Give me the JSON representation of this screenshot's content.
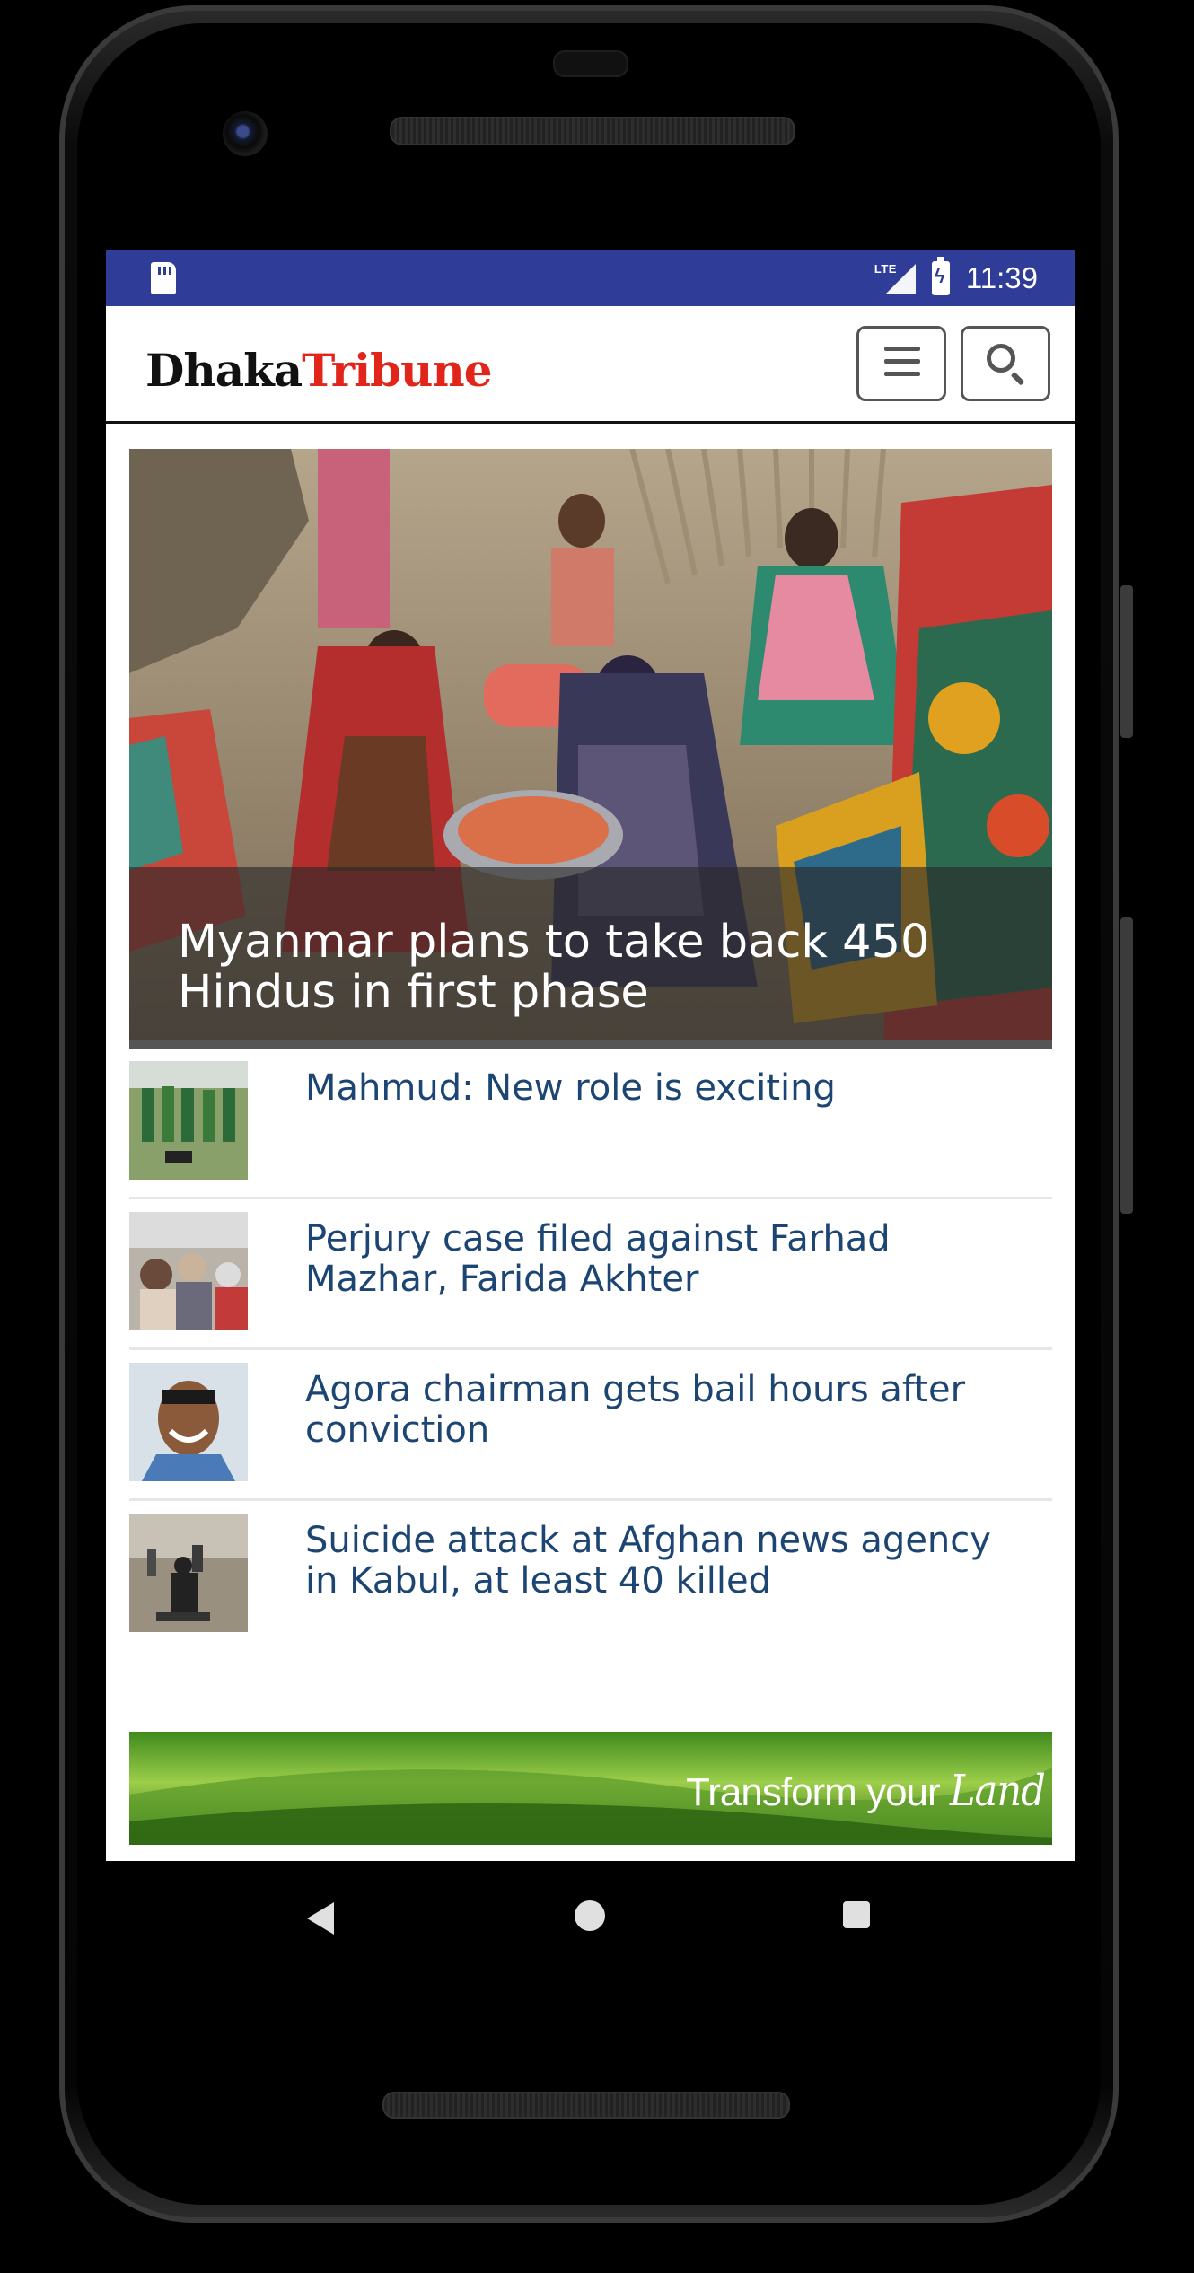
{
  "status_bar": {
    "network": "LTE",
    "time": "11:39",
    "icons": [
      "sd-card-icon",
      "lte-signal-icon",
      "battery-charging-icon"
    ]
  },
  "header": {
    "logo_part1": "Dhaka",
    "logo_part2": "Tribune",
    "icons": [
      "menu-icon",
      "search-icon"
    ]
  },
  "featured": {
    "headline": "Myanmar plans to take back 450 Hindus in first phase"
  },
  "news": [
    {
      "title": "Mahmud: New role is exciting"
    },
    {
      "title": "Perjury case filed against Farhad Mazhar, Farida Akhter"
    },
    {
      "title": "Agora chairman gets bail hours after conviction"
    },
    {
      "title": "Suicide attack at Afghan news agency in Kabul, at least 40 killed"
    }
  ],
  "ad": {
    "text_main": "Transform your",
    "text_accent": "Land"
  },
  "nav_bar": {
    "icons": [
      "back-icon",
      "home-icon",
      "recents-icon"
    ]
  },
  "colors": {
    "status_bar": "#2f3d99",
    "logo_red": "#e1251b",
    "headline_blue": "#1d4573"
  }
}
